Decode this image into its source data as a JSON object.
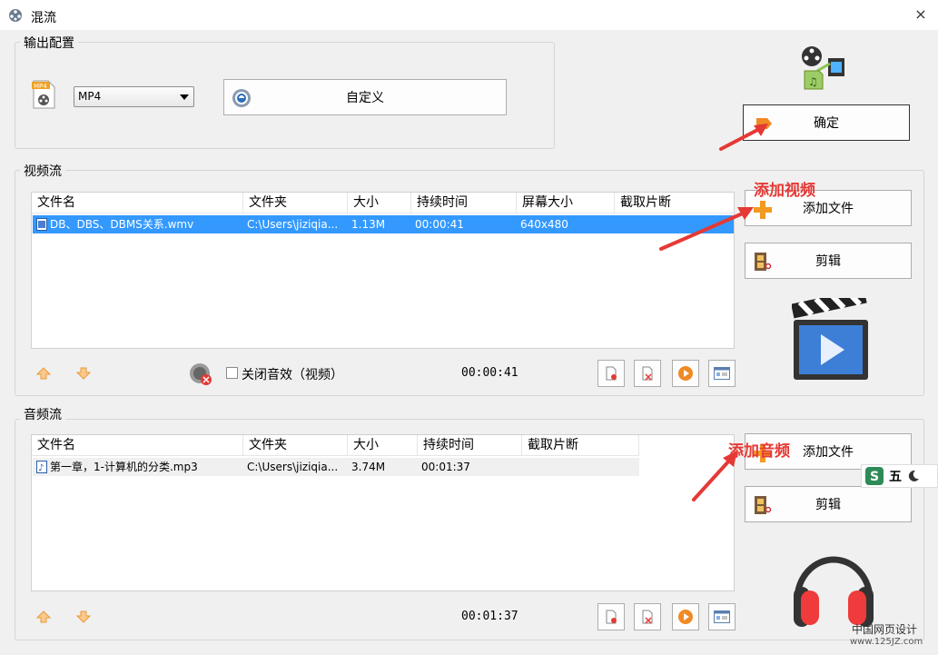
{
  "window": {
    "title": "混流",
    "close_glyph": "×"
  },
  "output": {
    "group_title": "输出配置",
    "format_icon": "mp4-file-icon",
    "format_selected": "MP4",
    "custom_label": "自定义",
    "confirm_label": "确定"
  },
  "video": {
    "group_title": "视频流",
    "columns": [
      "文件名",
      "文件夹",
      "大小",
      "持续时间",
      "屏幕大小",
      "截取片断"
    ],
    "rows": [
      {
        "name": "DB、DBS、DBMS关系.wmv",
        "folder": "C:\\Users\\jiziqia...",
        "size": "1.13M",
        "duration": "00:00:41",
        "screen": "640x480",
        "clip": ""
      }
    ],
    "mute_label": "关闭音效（视频）",
    "total_time": "00:00:41",
    "add_label": "添加文件",
    "edit_label": "剪辑",
    "annotation": "添加视频"
  },
  "audio": {
    "group_title": "音频流",
    "columns": [
      "文件名",
      "文件夹",
      "大小",
      "持续时间",
      "截取片断"
    ],
    "rows": [
      {
        "name": "第一章，1-计算机的分类.mp3",
        "folder": "C:\\Users\\jiziqia...",
        "size": "3.74M",
        "duration": "00:01:37",
        "clip": ""
      }
    ],
    "total_time": "00:01:37",
    "add_label": "添加文件",
    "edit_label": "剪辑",
    "annotation": "添加音频"
  },
  "ime": {
    "label": "五"
  },
  "watermark": {
    "line1": "中国网页设计",
    "line2": "www.125JZ.com"
  },
  "colors": {
    "accent": "#3399ff",
    "annotation": "#e53935"
  }
}
